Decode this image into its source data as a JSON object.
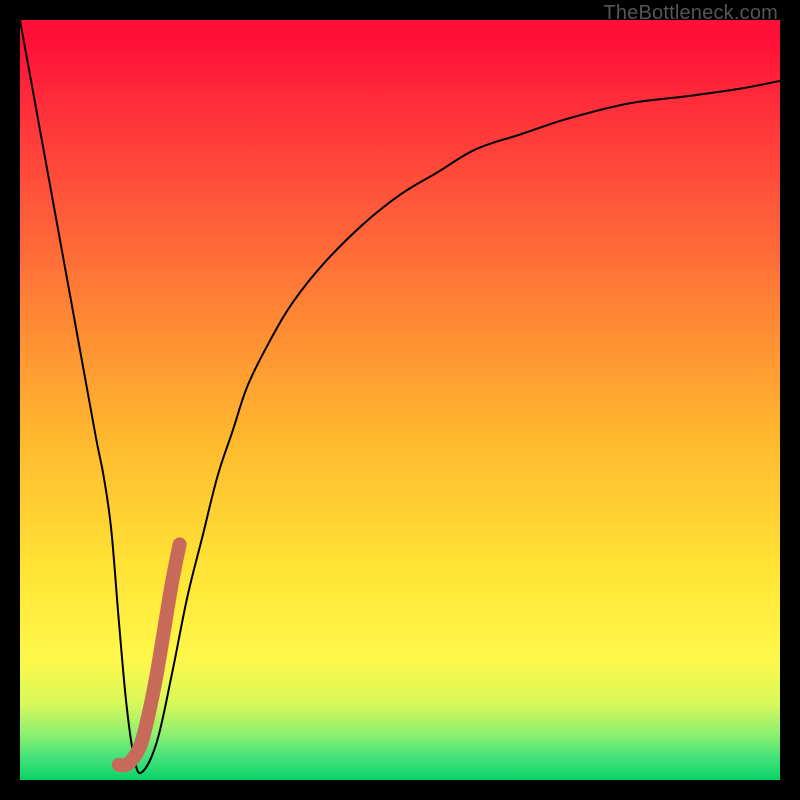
{
  "watermark": "TheBottleneck.com",
  "colors": {
    "frame": "#000000",
    "curve": "#000000",
    "highlight": "#c86a5a",
    "gradient_top": "#ff1038",
    "gradient_bottom": "#0ad065"
  },
  "chart_data": {
    "type": "line",
    "title": "",
    "xlabel": "",
    "ylabel": "",
    "xlim": [
      0,
      100
    ],
    "ylim": [
      0,
      100
    ],
    "grid": false,
    "legend": false,
    "series": [
      {
        "name": "bottleneck-curve",
        "x": [
          0,
          2,
          4,
          6,
          8,
          10,
          11,
          12,
          13,
          14,
          15,
          16,
          18,
          20,
          22,
          24,
          26,
          28,
          30,
          33,
          36,
          40,
          45,
          50,
          55,
          60,
          66,
          72,
          80,
          88,
          95,
          100
        ],
        "y": [
          100,
          89,
          78,
          67,
          56,
          45,
          40,
          33,
          21,
          10,
          3,
          1,
          5,
          14,
          24,
          32,
          40,
          46,
          52,
          58,
          63,
          68,
          73,
          77,
          80,
          83,
          85,
          87,
          89,
          90,
          91,
          92
        ]
      },
      {
        "name": "highlight-segment",
        "x": [
          13,
          14,
          15,
          16,
          17,
          18,
          19,
          20,
          21
        ],
        "y": [
          2,
          2,
          3,
          5,
          9,
          14,
          20,
          26,
          31
        ]
      }
    ]
  }
}
